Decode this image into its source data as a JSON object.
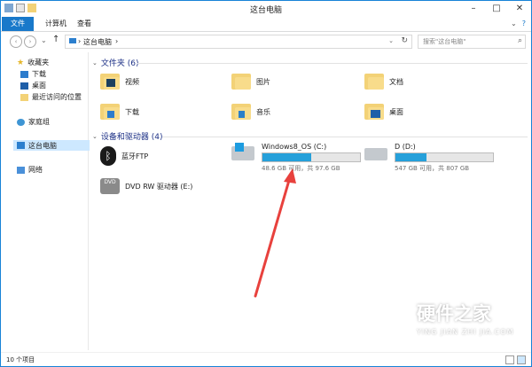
{
  "window": {
    "title": "这台电脑"
  },
  "ribbon": {
    "tabs": [
      "文件",
      "计算机",
      "查看"
    ]
  },
  "address": {
    "path": "这台电脑",
    "search_placeholder": "搜索\"这台电脑\""
  },
  "nav": {
    "favorites": "收藏夹",
    "fav_items": [
      "下载",
      "桌面",
      "最近访问的位置"
    ],
    "homegroup": "家庭组",
    "this_pc": "这台电脑",
    "network": "网络"
  },
  "folders": {
    "header": "文件夹 (6)",
    "items": [
      "视频",
      "图片",
      "文档",
      "下载",
      "音乐",
      "桌面"
    ]
  },
  "devices": {
    "header": "设备和驱动器 (4)",
    "bluetooth": "蓝牙FTP",
    "dvd": "DVD RW 驱动器 (E:)",
    "drive_c": {
      "name": "Windows8_OS (C:)",
      "free": "48.6 GB 可用，共 97.6 GB",
      "used_fraction": 0.502
    },
    "drive_d": {
      "name": "D (D:)",
      "free": "547 GB 可用，共 807 GB",
      "used_fraction": 0.322
    }
  },
  "status": {
    "count": "10 个项目"
  },
  "watermark": {
    "brand": "硬件之家",
    "sub": "YING JIAN ZHI JIA.COM"
  },
  "colors": {
    "accent": "#1979ca",
    "bar": "#26a0da",
    "arrow": "#e8413d"
  }
}
